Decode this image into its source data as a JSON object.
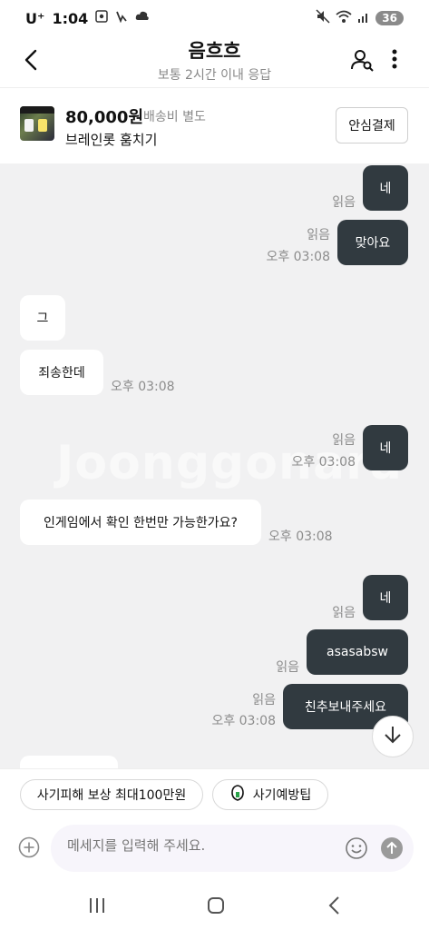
{
  "status_bar": {
    "carrier": "U⁺",
    "time": "1:04",
    "battery": "36"
  },
  "header": {
    "title": "음흐흐",
    "subtitle": "보통 2시간 이내 응답"
  },
  "product": {
    "price": "80,000원",
    "shipping": "배송비 별도",
    "name": "브레인롯 훔치기",
    "safe_pay_label": "안심결제"
  },
  "chat": {
    "watermark": "Joonggonara",
    "messages": [
      {
        "side": "mine",
        "text": "네",
        "read": "읽음",
        "time": ""
      },
      {
        "side": "mine",
        "text": "맞아요",
        "read": "읽음",
        "time": "오후 03:08"
      },
      {
        "side": "theirs",
        "text": "그",
        "time": ""
      },
      {
        "side": "theirs",
        "text": "죄송한데",
        "time": "오후 03:08"
      },
      {
        "side": "mine",
        "text": "네",
        "read": "읽음",
        "time": "오후 03:08"
      },
      {
        "side": "theirs",
        "text": "인게임에서 확인 한번만 가능한가요?",
        "time": "오후 03:08"
      },
      {
        "side": "mine",
        "text": "네",
        "read": "읽음",
        "time": ""
      },
      {
        "side": "mine",
        "text": "asasabsw",
        "read": "읽음",
        "time": ""
      },
      {
        "side": "mine",
        "text": "친추보내주세요",
        "read": "읽음",
        "time": "오후 03:08"
      }
    ]
  },
  "chips": {
    "fraud_compensation": "사기피해 보상 최대100만원",
    "fraud_tips": "사기예방팁"
  },
  "composer": {
    "placeholder": "메세지를 입력해 주세요."
  },
  "colors": {
    "my_bubble": "#313a40",
    "chat_background": "#f1f1f2"
  },
  "icons": [
    "back-icon",
    "user-search-icon",
    "more-vertical-icon",
    "arrow-down-icon",
    "plus-circle-icon",
    "emoji-icon",
    "send-icon",
    "shield-icon",
    "nav-recent-icon",
    "nav-home-icon",
    "nav-back-icon"
  ]
}
